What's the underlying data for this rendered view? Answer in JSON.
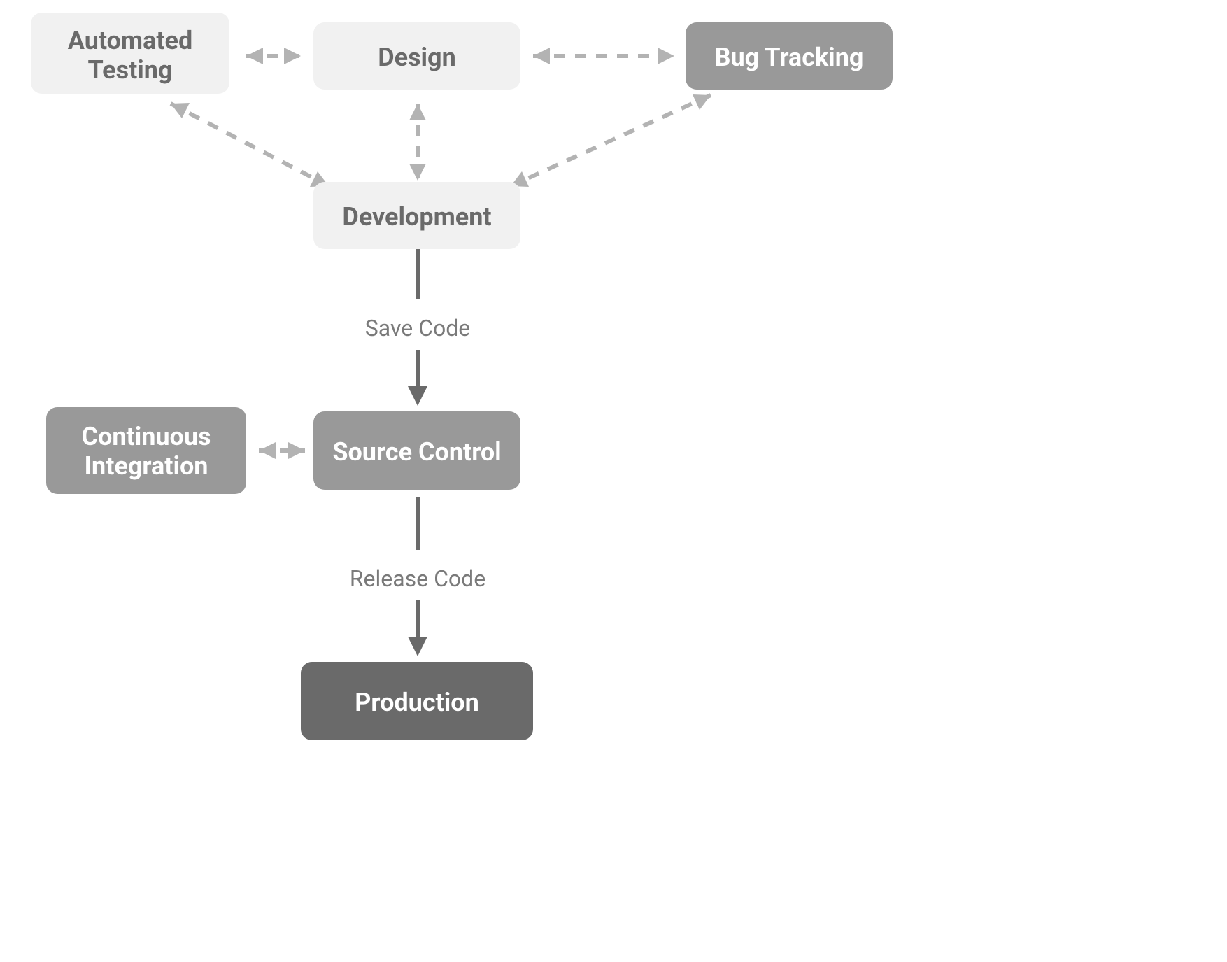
{
  "nodes": {
    "automated_testing_l1": "Automated",
    "automated_testing_l2": "Testing",
    "design": "Design",
    "bug_tracking": "Bug Tracking",
    "development": "Development",
    "ci_l1": "Continuous",
    "ci_l2": "Integration",
    "source_control": "Source Control",
    "production": "Production"
  },
  "edges": {
    "save_code": "Save Code",
    "release_code": "Release Code"
  },
  "colors": {
    "node_light": "#f1f1f1",
    "node_gray": "#999999",
    "node_dark": "#6a6a6a",
    "text_dark": "#6a6a6a",
    "text_white": "#ffffff",
    "dashed": "#b3b3b3"
  },
  "diagram": {
    "type": "flowchart",
    "connections": [
      {
        "from": "Design",
        "to": "Automated Testing",
        "style": "dashed",
        "bidirectional": true
      },
      {
        "from": "Design",
        "to": "Bug Tracking",
        "style": "dashed",
        "bidirectional": true
      },
      {
        "from": "Design",
        "to": "Development",
        "style": "dashed",
        "bidirectional": true
      },
      {
        "from": "Automated Testing",
        "to": "Development",
        "style": "dashed",
        "bidirectional": true
      },
      {
        "from": "Bug Tracking",
        "to": "Development",
        "style": "dashed",
        "bidirectional": true
      },
      {
        "from": "Development",
        "to": "Source Control",
        "style": "solid",
        "label": "Save Code"
      },
      {
        "from": "Source Control",
        "to": "Continuous Integration",
        "style": "dashed",
        "bidirectional": true
      },
      {
        "from": "Source Control",
        "to": "Production",
        "style": "solid",
        "label": "Release Code"
      }
    ]
  }
}
